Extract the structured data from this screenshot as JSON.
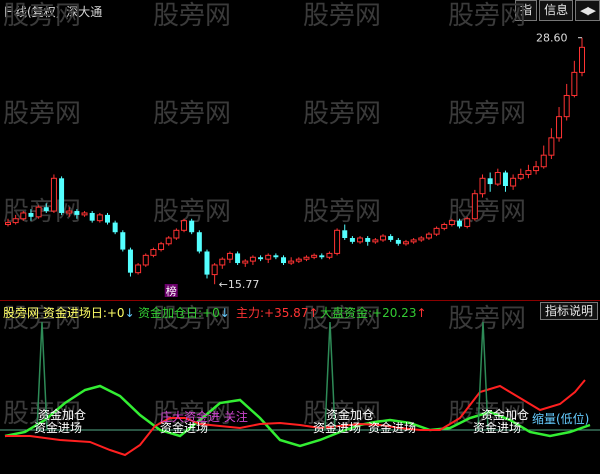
{
  "header": {
    "period": "日线(复权)",
    "stock": "深大通",
    "buttons": {
      "index": "指",
      "info": "信息",
      "nav": "◀▶"
    }
  },
  "price_chart": {
    "high_label": "28.60",
    "low_label": "15.77",
    "badge": "榜"
  },
  "indicator_bar": {
    "items": [
      {
        "label": "股旁网 资金进场日:",
        "value": "+0",
        "arrow": "↓",
        "color": "#ffff66"
      },
      {
        "label": "资金加仓日:",
        "value": "+0",
        "arrow": "↓",
        "color": "#33cc33"
      },
      {
        "label": "主力:",
        "value": "+35.87",
        "arrow": "↑",
        "color": "#ff3333"
      },
      {
        "label": "大盘资金:",
        "value": "+20.23",
        "arrow": "↑",
        "color": "#33cc33"
      }
    ],
    "help_button": "指标说明"
  },
  "indicator_labels": {
    "add_position": "资金加仓",
    "enter": "资金进场",
    "chinese_label": "庄大资金进 关注",
    "shrink": "缩量(低位)"
  },
  "watermark": "股旁网",
  "colors": {
    "background": "#000000",
    "up": "#ff3333",
    "down": "#54ffff",
    "main_line": "#ff2020",
    "market_line": "#33ee33",
    "spike_line": "#2e8b57",
    "divider": "#8b0000"
  },
  "chart_data": {
    "type": "candlestick",
    "price_range": [
      15.5,
      29.0
    ],
    "max_marked": 28.6,
    "min_marked": 15.77,
    "candles": [
      [
        18.9,
        19.0,
        19.2,
        18.8
      ],
      [
        19.0,
        19.2,
        19.4,
        18.9
      ],
      [
        19.2,
        19.5,
        19.6,
        19.1
      ],
      [
        19.5,
        19.3,
        19.7,
        19.1
      ],
      [
        19.3,
        19.8,
        19.9,
        19.2
      ],
      [
        19.8,
        19.6,
        20.0,
        19.5
      ],
      [
        19.6,
        21.3,
        21.5,
        19.5
      ],
      [
        21.3,
        19.5,
        21.4,
        19.4
      ],
      [
        19.5,
        19.6,
        19.8,
        19.3
      ],
      [
        19.6,
        19.4,
        19.7,
        19.2
      ],
      [
        19.4,
        19.5,
        19.6,
        19.3
      ],
      [
        19.5,
        19.1,
        19.6,
        19.0
      ],
      [
        19.1,
        19.4,
        19.5,
        19.0
      ],
      [
        19.4,
        19.0,
        19.5,
        18.9
      ],
      [
        19.0,
        18.5,
        19.1,
        18.4
      ],
      [
        18.5,
        17.6,
        18.6,
        17.5
      ],
      [
        17.6,
        16.4,
        17.7,
        16.2
      ],
      [
        16.4,
        16.8,
        16.9,
        16.3
      ],
      [
        16.8,
        17.3,
        17.4,
        16.7
      ],
      [
        17.3,
        17.6,
        17.7,
        17.2
      ],
      [
        17.6,
        17.9,
        18.0,
        17.5
      ],
      [
        17.9,
        18.2,
        18.3,
        17.8
      ],
      [
        18.2,
        18.6,
        18.7,
        18.1
      ],
      [
        18.6,
        19.1,
        19.2,
        18.5
      ],
      [
        19.1,
        18.5,
        19.2,
        18.4
      ],
      [
        18.5,
        17.5,
        18.6,
        17.4
      ],
      [
        17.5,
        16.3,
        17.6,
        16.1
      ],
      [
        16.3,
        16.8,
        16.9,
        15.8
      ],
      [
        16.8,
        17.1,
        17.2,
        16.6
      ],
      [
        17.1,
        17.4,
        17.5,
        16.9
      ],
      [
        17.4,
        16.9,
        17.5,
        16.8
      ],
      [
        16.9,
        17.0,
        17.1,
        16.7
      ],
      [
        17.0,
        17.2,
        17.3,
        16.8
      ],
      [
        17.2,
        17.1,
        17.3,
        17.0
      ],
      [
        17.1,
        17.3,
        17.4,
        16.9
      ],
      [
        17.3,
        17.2,
        17.4,
        17.1
      ],
      [
        17.2,
        16.9,
        17.3,
        16.8
      ],
      [
        16.9,
        17.0,
        17.2,
        16.8
      ],
      [
        17.0,
        17.1,
        17.2,
        16.9
      ],
      [
        17.1,
        17.2,
        17.3,
        17.0
      ],
      [
        17.2,
        17.3,
        17.4,
        17.1
      ],
      [
        17.3,
        17.2,
        17.4,
        17.1
      ],
      [
        17.2,
        17.4,
        17.5,
        17.1
      ],
      [
        17.4,
        18.6,
        18.7,
        17.3
      ],
      [
        18.6,
        18.2,
        18.9,
        18.1
      ],
      [
        18.2,
        18.0,
        18.3,
        17.9
      ],
      [
        18.0,
        18.2,
        18.3,
        17.9
      ],
      [
        18.2,
        18.0,
        18.3,
        17.8
      ],
      [
        18.0,
        18.1,
        18.2,
        17.9
      ],
      [
        18.1,
        18.3,
        18.4,
        18.0
      ],
      [
        18.3,
        18.1,
        18.4,
        18.0
      ],
      [
        18.1,
        17.9,
        18.2,
        17.8
      ],
      [
        17.9,
        18.0,
        18.1,
        17.8
      ],
      [
        18.0,
        18.1,
        18.2,
        17.9
      ],
      [
        18.1,
        18.2,
        18.3,
        18.0
      ],
      [
        18.2,
        18.4,
        18.5,
        18.1
      ],
      [
        18.4,
        18.7,
        18.8,
        18.3
      ],
      [
        18.7,
        18.9,
        19.0,
        18.6
      ],
      [
        18.9,
        19.1,
        19.2,
        18.8
      ],
      [
        19.1,
        18.8,
        19.2,
        18.7
      ],
      [
        18.8,
        19.2,
        19.3,
        18.7
      ],
      [
        19.2,
        20.5,
        20.7,
        19.1
      ],
      [
        20.5,
        21.3,
        21.5,
        20.3
      ],
      [
        21.3,
        21.0,
        21.6,
        20.6
      ],
      [
        21.0,
        21.6,
        21.8,
        20.9
      ],
      [
        21.6,
        20.9,
        21.7,
        20.6
      ],
      [
        20.9,
        21.3,
        21.5,
        20.7
      ],
      [
        21.3,
        21.5,
        21.8,
        21.2
      ],
      [
        21.5,
        21.7,
        22.0,
        21.3
      ],
      [
        21.7,
        21.9,
        22.2,
        21.5
      ],
      [
        21.9,
        22.5,
        23.0,
        21.8
      ],
      [
        22.5,
        23.4,
        23.9,
        22.3
      ],
      [
        23.4,
        24.5,
        25.0,
        23.2
      ],
      [
        24.5,
        25.6,
        26.2,
        24.3
      ],
      [
        25.6,
        26.8,
        27.4,
        25.5
      ],
      [
        26.8,
        28.1,
        28.6,
        26.6
      ]
    ]
  }
}
